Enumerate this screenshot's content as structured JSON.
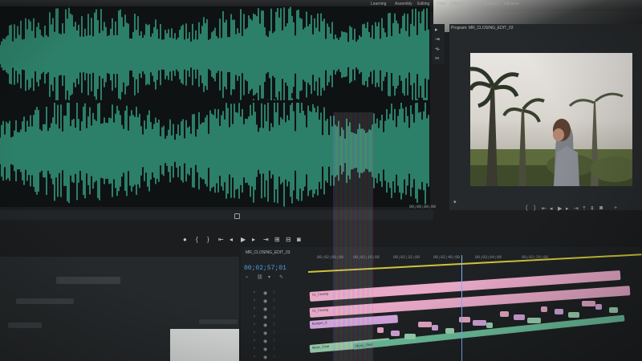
{
  "workspace_tabs": [
    "Learning",
    "Assembly",
    "Editing",
    "Color",
    "Effects",
    "Audio",
    "Graphics",
    "Libraries"
  ],
  "source": {
    "waveform_color": "#3fbf9a",
    "timecode": "00;00;00;00"
  },
  "program": {
    "title": "Program: MR_CLOSING_EDIT_03",
    "controls": [
      "marker-icon",
      "in-point-icon",
      "out-point-icon",
      "step-back-icon",
      "play-icon",
      "step-forward-icon",
      "lift-icon",
      "extract-icon",
      "export-frame-icon"
    ]
  },
  "transport": {
    "buttons": [
      "marker-icon",
      "in-point-icon",
      "out-point-icon",
      "go-to-in-icon",
      "step-back-icon",
      "play-icon",
      "step-forward-icon",
      "go-to-out-icon",
      "insert-icon",
      "overwrite-icon",
      "export-frame-icon"
    ]
  },
  "project": {
    "field_labels": [
      "",
      "",
      ""
    ]
  },
  "timeline": {
    "sequence_name": "MR_CLOSING_EDIT_03",
    "timecode": "00;02;57;01",
    "ruler": [
      "00;02;00;00",
      "00;02;16;00",
      "00;02;32;00",
      "00;02;48;00",
      "00;03;04;00",
      "00;03;20;00"
    ],
    "clips": [
      {
        "label": "V1_Closing",
        "color": "#e8a9c8"
      },
      {
        "label": "V1_Closing",
        "color": "#e8a9c8"
      },
      {
        "label": "Bumper_A",
        "color": "#d6a8e0"
      },
      {
        "label": "Music_Final",
        "color": "#9fd7b4"
      },
      {
        "label": "Music_Final",
        "color": "#9fd7b4"
      }
    ],
    "accent_colors": {
      "playhead": "#7ab3ff",
      "timecode": "#4e9de5",
      "rubberband": "#cfc43a"
    }
  }
}
